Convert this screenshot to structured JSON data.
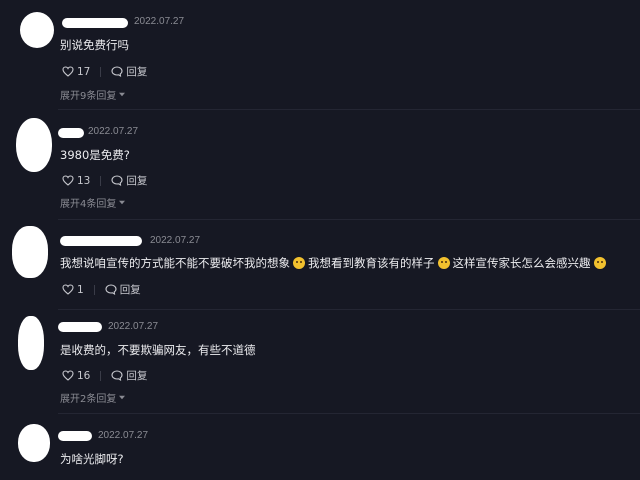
{
  "comments": [
    {
      "time": "2022.07.27",
      "text": "别说免费行吗",
      "likes": "17",
      "reply_label": "回复",
      "expand_label": "展开9条回复"
    },
    {
      "time": "2022.07.27",
      "text": "3980是免费?",
      "likes": "13",
      "reply_label": "回复",
      "expand_label": "展开4条回复"
    },
    {
      "time": "2022.07.27",
      "text_parts": [
        "我想说咱宣传的方式能不能不要破坏我的想象",
        "我想看到教育该有的样子",
        "这样宣传家长怎么会感兴趣"
      ],
      "likes": "1",
      "reply_label": "回复"
    },
    {
      "time": "2022.07.27",
      "text": "是收费的，不要欺骗网友，有些不道德",
      "likes": "16",
      "reply_label": "回复",
      "expand_label": "展开2条回复"
    },
    {
      "time": "2022.07.27",
      "text": "为啥光脚呀?"
    }
  ],
  "icons": {
    "like": "heart-outline-icon",
    "reply": "speech-bubble-icon",
    "expand": "chevron-down-icon",
    "emoji_1": "laughing-tears-emoji-icon",
    "emoji_2": "thinking-emoji-icon",
    "emoji_3": "thinking-emoji-icon"
  },
  "colors": {
    "background": "#161823",
    "text": "#ececef",
    "muted": "#8a8b93"
  }
}
